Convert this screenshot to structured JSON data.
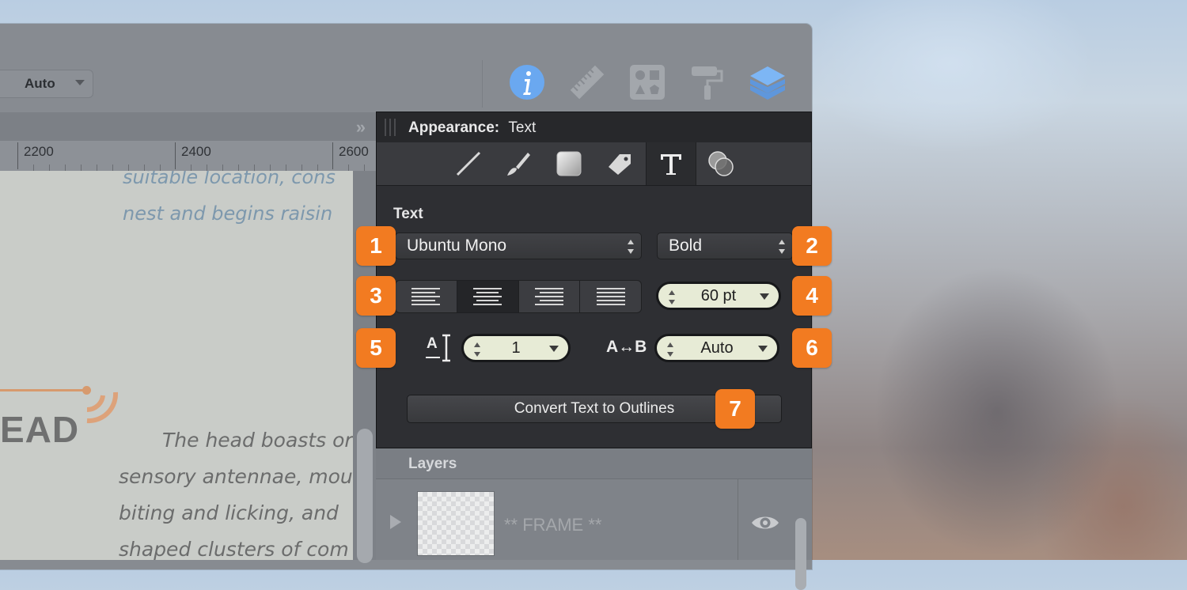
{
  "toolbar": {
    "zoom_value": "Auto",
    "icons": [
      "info-icon",
      "ruler-icon",
      "shapes-icon",
      "paint-roller-icon",
      "layers-icon"
    ],
    "accent_color": "#6aa8f0"
  },
  "ruler": {
    "labels": [
      "2200",
      "2400",
      "2600"
    ]
  },
  "canvas": {
    "lines": [
      "suitable location, cons",
      "nest and begins raisin",
      "The head boasts or",
      "sensory antennae, mou",
      "biting and licking, and",
      "shaped clusters of com"
    ],
    "heading": "EAD"
  },
  "panel": {
    "title_prefix": "Appearance:",
    "title_value": "Text",
    "tabs": [
      "stroke-icon",
      "brush-icon",
      "fill-icon",
      "eraser-icon",
      "text-icon",
      "effects-icon"
    ],
    "section": "Text",
    "font_family": "Ubuntu Mono",
    "font_style": "Bold",
    "alignments": [
      "align-left-icon",
      "align-center-icon",
      "align-right-icon",
      "align-justify-icon"
    ],
    "font_size": "60 pt",
    "line_height_label": "A",
    "line_height": "1",
    "tracking_label": "A↔B",
    "tracking": "Auto",
    "convert_button": "Convert Text to Outlines",
    "badge_color": "#f27b21",
    "badges": [
      "1",
      "2",
      "3",
      "4",
      "5",
      "6",
      "7"
    ]
  },
  "layers": {
    "title": "Layers",
    "items": [
      {
        "name": "** FRAME **"
      }
    ]
  }
}
